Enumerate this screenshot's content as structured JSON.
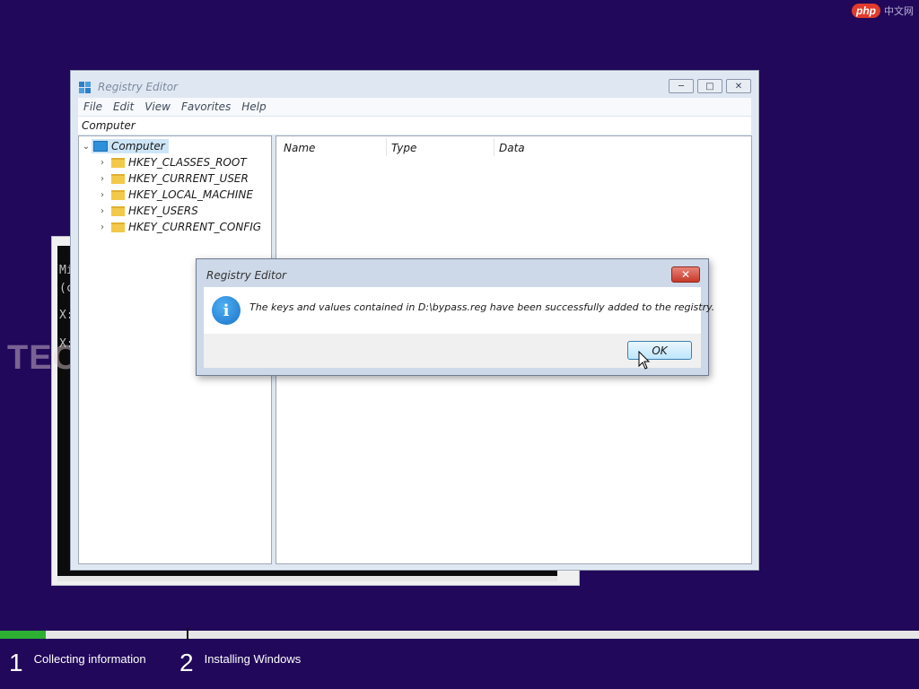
{
  "site_mark": {
    "logo": "php",
    "text": "中文网"
  },
  "watermark": "TECHPOWERUP",
  "console": {
    "lines": [
      "Mi",
      "(c",
      "X:",
      "X:"
    ]
  },
  "registry": {
    "title": "Registry Editor",
    "menu": [
      "File",
      "Edit",
      "View",
      "Favorites",
      "Help"
    ],
    "address": "Computer",
    "tree": {
      "root": "Computer",
      "keys": [
        "HKEY_CLASSES_ROOT",
        "HKEY_CURRENT_USER",
        "HKEY_LOCAL_MACHINE",
        "HKEY_USERS",
        "HKEY_CURRENT_CONFIG"
      ]
    },
    "columns": [
      "Name",
      "Type",
      "Data"
    ]
  },
  "dialog": {
    "title": "Registry Editor",
    "message": "The keys and values contained in D:\\bypass.reg have been successfully added to the registry.",
    "ok_label": "OK"
  },
  "setup": {
    "progress_fraction": 0.05,
    "steps": [
      {
        "num": "1",
        "label": "Collecting information"
      },
      {
        "num": "2",
        "label": "Installing Windows"
      }
    ]
  },
  "colors": {
    "desktop": "#21085a",
    "progress": "#2db032",
    "accent": "#1a73c8"
  }
}
